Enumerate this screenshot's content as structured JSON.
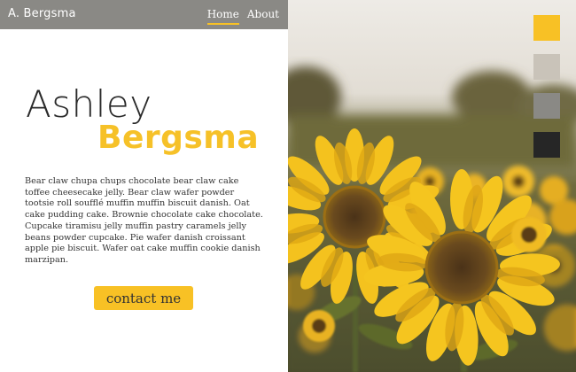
{
  "nav": {
    "brand": "A. Bergsma",
    "links": [
      {
        "label": "Home",
        "active": true
      },
      {
        "label": "About",
        "active": false
      }
    ]
  },
  "hero": {
    "first_name": "Ashley",
    "last_name": "Bergsma"
  },
  "bio": "Bear claw chupa chups chocolate bear claw cake toffee cheesecake jelly. Bear claw wafer powder tootsie roll soufflé muffin muffin biscuit danish. Oat cake pudding cake. Brownie chocolate cake chocolate. Cupcake tiramisu jelly muffin pastry caramels jelly beans powder cupcake. Pie wafer danish croissant apple pie biscuit. Wafer oat cake muffin cookie danish marzipan.",
  "contact_button": "contact me",
  "palette": [
    "#f8c125",
    "#c9c3b9",
    "#8a8985",
    "#262626"
  ],
  "photo": {
    "subject": "sunflower field"
  },
  "colors": {
    "accent": "#f8c125",
    "nav_bg": "#8a8985",
    "text_dark": "#2a2a2a"
  }
}
